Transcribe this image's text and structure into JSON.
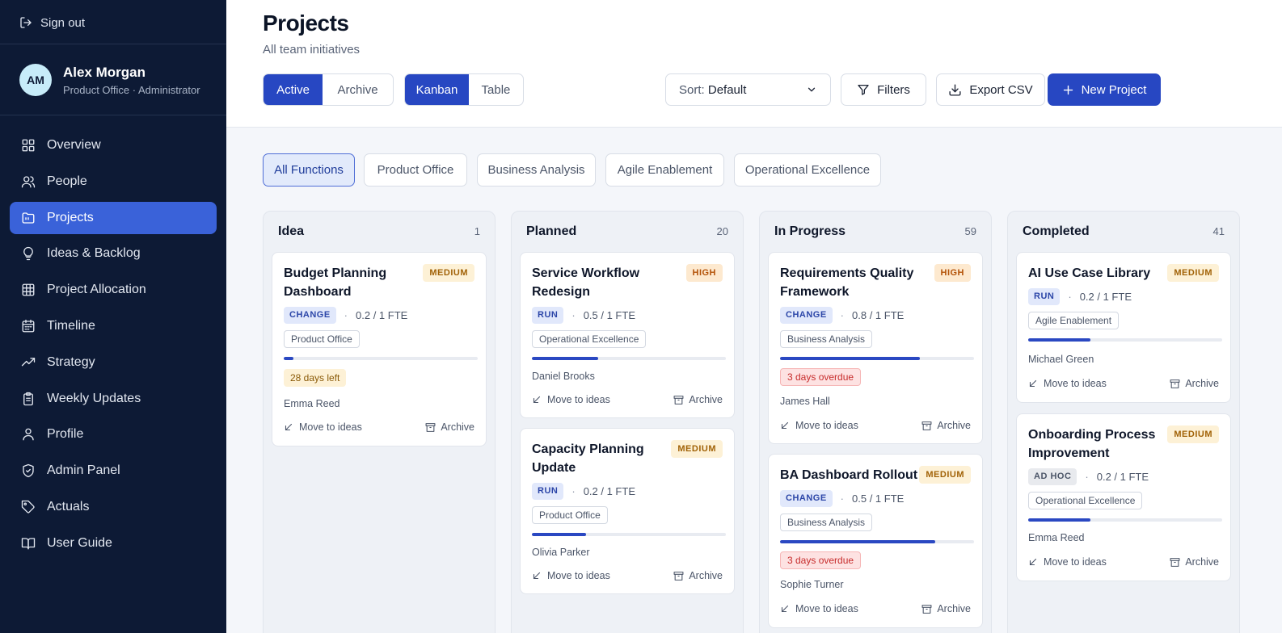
{
  "sidebar": {
    "signout_label": "Sign out",
    "user": {
      "initials": "AM",
      "name": "Alex Morgan",
      "role": "Product Office · Administrator"
    },
    "items": [
      {
        "label": "Overview",
        "icon": "grid-icon"
      },
      {
        "label": "People",
        "icon": "users-icon"
      },
      {
        "label": "Projects",
        "icon": "folder-icon",
        "active": true
      },
      {
        "label": "Ideas & Backlog",
        "icon": "lightbulb-icon"
      },
      {
        "label": "Project Allocation",
        "icon": "table-icon"
      },
      {
        "label": "Timeline",
        "icon": "calendar-icon"
      },
      {
        "label": "Strategy",
        "icon": "trending-up-icon"
      },
      {
        "label": "Weekly Updates",
        "icon": "clipboard-icon"
      },
      {
        "label": "Profile",
        "icon": "user-icon"
      },
      {
        "label": "Admin Panel",
        "icon": "shield-icon"
      },
      {
        "label": "Actuals",
        "icon": "tag-icon"
      },
      {
        "label": "User Guide",
        "icon": "book-icon"
      }
    ]
  },
  "header": {
    "title": "Projects",
    "subtitle": "All team initiatives",
    "status_toggle": {
      "active": "Active",
      "archive": "Archive"
    },
    "view_toggle": {
      "kanban": "Kanban",
      "table": "Table"
    },
    "sort": {
      "label": "Sort:",
      "value": "Default"
    },
    "filters_label": "Filters",
    "export_label": "Export CSV",
    "new_label": "New Project"
  },
  "function_filters": [
    "All Functions",
    "Product Office",
    "Business Analysis",
    "Agile Enablement",
    "Operational Excellence"
  ],
  "card_actions": {
    "move": "Move to ideas",
    "archive": "Archive"
  },
  "columns": [
    {
      "name": "Idea",
      "count": "1",
      "cards": [
        {
          "title": "Budget Planning Dashboard",
          "priority": "MEDIUM",
          "type": "CHANGE",
          "fte": "0.2 / 1 FTE",
          "function": "Product Office",
          "progress": 0.05,
          "due": "28 days left",
          "owner": "Emma Reed"
        }
      ]
    },
    {
      "name": "Planned",
      "count": "20",
      "cards": [
        {
          "title": "Service Workflow Redesign",
          "priority": "HIGH",
          "type": "RUN",
          "fte": "0.5 / 1 FTE",
          "function": "Operational Excellence",
          "progress": 0.34,
          "owner": "Daniel Brooks"
        },
        {
          "title": "Capacity Planning Update",
          "priority": "MEDIUM",
          "type": "RUN",
          "fte": "0.2 / 1 FTE",
          "function": "Product Office",
          "progress": 0.28,
          "owner": "Olivia Parker"
        }
      ]
    },
    {
      "name": "In Progress",
      "count": "59",
      "cards": [
        {
          "title": "Requirements Quality Framework",
          "priority": "HIGH",
          "type": "CHANGE",
          "fte": "0.8 / 1 FTE",
          "function": "Business Analysis",
          "progress": 0.72,
          "due": "3 days overdue",
          "owner": "James Hall"
        },
        {
          "title": "BA Dashboard Rollout",
          "priority": "MEDIUM",
          "type": "CHANGE",
          "fte": "0.5 / 1 FTE",
          "function": "Business Analysis",
          "progress": 0.8,
          "due": "3 days overdue",
          "owner": "Sophie Turner"
        }
      ]
    },
    {
      "name": "Completed",
      "count": "41",
      "cards": [
        {
          "title": "AI Use Case Library",
          "priority": "MEDIUM",
          "type": "RUN",
          "fte": "0.2 / 1 FTE",
          "function": "Agile Enablement",
          "progress": 0.32,
          "owner": "Michael Green"
        },
        {
          "title": "Onboarding Process Improvement",
          "priority": "MEDIUM",
          "type": "AD HOC",
          "fte": "0.2 / 1 FTE",
          "function": "Operational Excellence",
          "progress": 0.32,
          "owner": "Emma Reed"
        }
      ]
    }
  ]
}
